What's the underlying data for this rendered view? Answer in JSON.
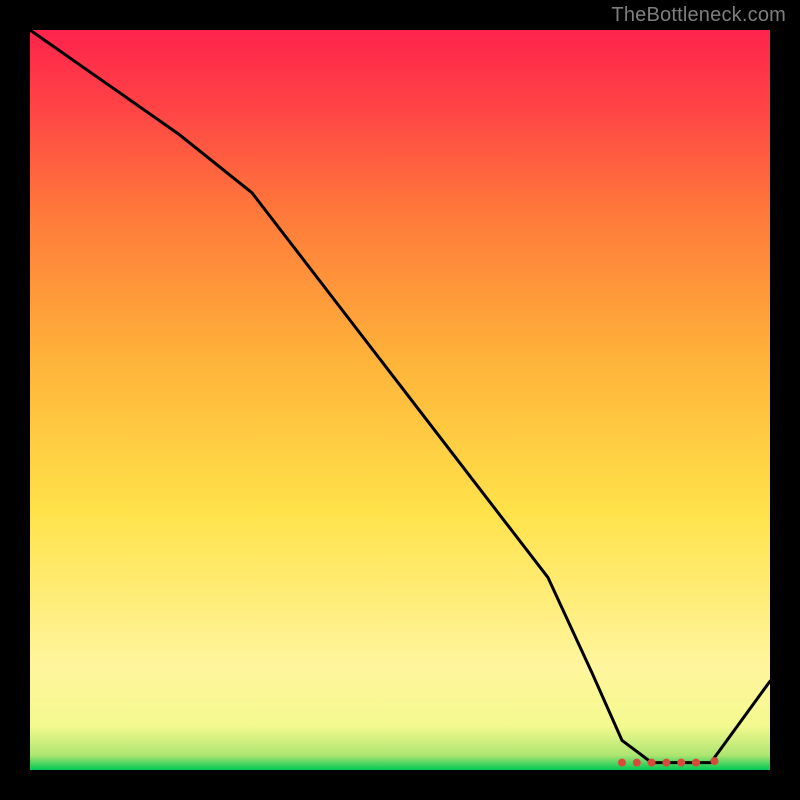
{
  "watermark": "TheBottleneck.com",
  "chart_data": {
    "type": "line",
    "title": "",
    "xlabel": "",
    "ylabel": "",
    "xlim": [
      0,
      100
    ],
    "ylim": [
      0,
      100
    ],
    "grid": false,
    "legend": false,
    "x": [
      0,
      10,
      20,
      30,
      40,
      50,
      60,
      70,
      76,
      80,
      84,
      88,
      92,
      100
    ],
    "values": [
      100,
      93,
      86,
      78,
      65,
      52,
      39,
      26,
      13,
      4,
      1,
      1,
      1,
      12
    ],
    "annotation": {
      "text": "",
      "x": 85,
      "y": 1
    },
    "gradient_stops": [
      {
        "offset": 0.0,
        "color": "#00c853"
      },
      {
        "offset": 0.02,
        "color": "#aee571"
      },
      {
        "offset": 0.06,
        "color": "#f4f98f"
      },
      {
        "offset": 0.14,
        "color": "#fff59d"
      },
      {
        "offset": 0.35,
        "color": "#ffe24a"
      },
      {
        "offset": 0.55,
        "color": "#ffb43a"
      },
      {
        "offset": 0.75,
        "color": "#ff7a3a"
      },
      {
        "offset": 0.9,
        "color": "#ff4246"
      },
      {
        "offset": 1.0,
        "color": "#ff234c"
      }
    ],
    "marker_points": [
      {
        "x": 80,
        "y": 1
      },
      {
        "x": 82,
        "y": 1
      },
      {
        "x": 84,
        "y": 1
      },
      {
        "x": 86,
        "y": 1
      },
      {
        "x": 88,
        "y": 1
      },
      {
        "x": 90,
        "y": 1
      },
      {
        "x": 92.5,
        "y": 1.2
      }
    ]
  }
}
